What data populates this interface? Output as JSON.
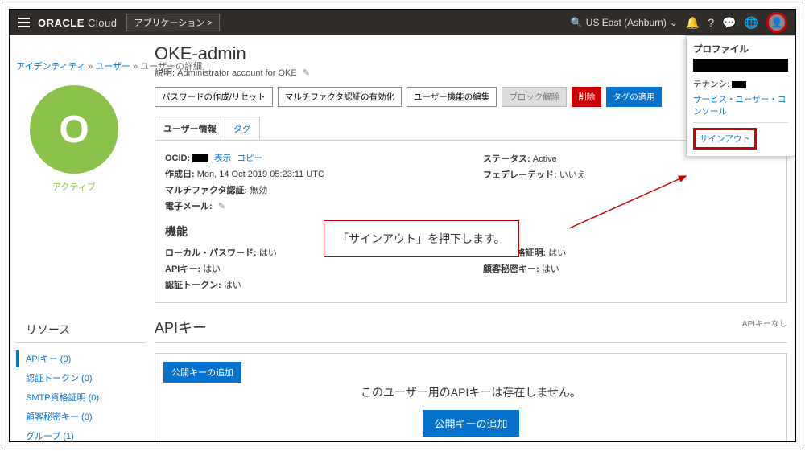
{
  "topbar": {
    "brand1": "ORACLE",
    "brand2": "Cloud",
    "app_btn": "アプリケーション >",
    "region": "US East (Ashburn)"
  },
  "breadcrumb": {
    "a": "アイデンティティ",
    "b": "ユーザー",
    "c": "ユーザーの詳細"
  },
  "avatar": {
    "letter": "O",
    "status": "アクティブ"
  },
  "page_title": "OKE-admin",
  "desc_label": "説明:",
  "desc_value": "Administrator account for OKE",
  "actions": {
    "pw_reset": "パスワードの作成/リセット",
    "mfa_enable": "マルチファクタ認証の有効化",
    "edit_attrs": "ユーザー機能の編集",
    "unblock": "ブロック解除",
    "delete": "削除",
    "apply_tags": "タグの適用"
  },
  "tabs": {
    "info": "ユーザー情報",
    "tags": "タグ"
  },
  "info_left": {
    "ocid_k": "OCID:",
    "ocid_show": "表示",
    "ocid_copy": "コピー",
    "created_k": "作成日:",
    "created_v": "Mon, 14 Oct 2019 05:23:11 UTC",
    "mfa_k": "マルチファクタ認証:",
    "mfa_v": "無効",
    "email_k": "電子メール:"
  },
  "info_right": {
    "status_k": "ステータス:",
    "status_v": "Active",
    "federated_k": "フェデレーテッド:",
    "federated_v": "いいえ"
  },
  "functions_h": "機能",
  "func_left": {
    "local_pw_k": "ローカル・パスワード:",
    "local_pw_v": "はい",
    "apikey_k": "APIキー:",
    "apikey_v": "はい",
    "auth_token_k": "認証トークン:",
    "auth_token_v": "はい"
  },
  "func_right": {
    "smtp_k": "SMTP資格証明:",
    "smtp_v": "はい",
    "secret_k": "顧客秘密キー:",
    "secret_v": "はい"
  },
  "callout_text": "「サインアウト」を押下します。",
  "profile_panel": {
    "h": "プロファイル",
    "tenancy": "テナンシ:",
    "svc_console": "サービス・ユーザー・コンソール",
    "signout": "サインアウト"
  },
  "resources": {
    "heading": "リソース",
    "items": [
      {
        "label": "APIキー (0)",
        "active": true
      },
      {
        "label": "認証トークン (0)"
      },
      {
        "label": "SMTP資格証明 (0)"
      },
      {
        "label": "顧客秘密キー (0)"
      },
      {
        "label": "グループ (1)"
      }
    ]
  },
  "api": {
    "heading": "APIキー",
    "count": "APIキーなし",
    "add_btn": "公開キーの追加",
    "empty_text": "このユーザー用のAPIキーは存在しません。",
    "mid_btn": "公開キーの追加"
  }
}
